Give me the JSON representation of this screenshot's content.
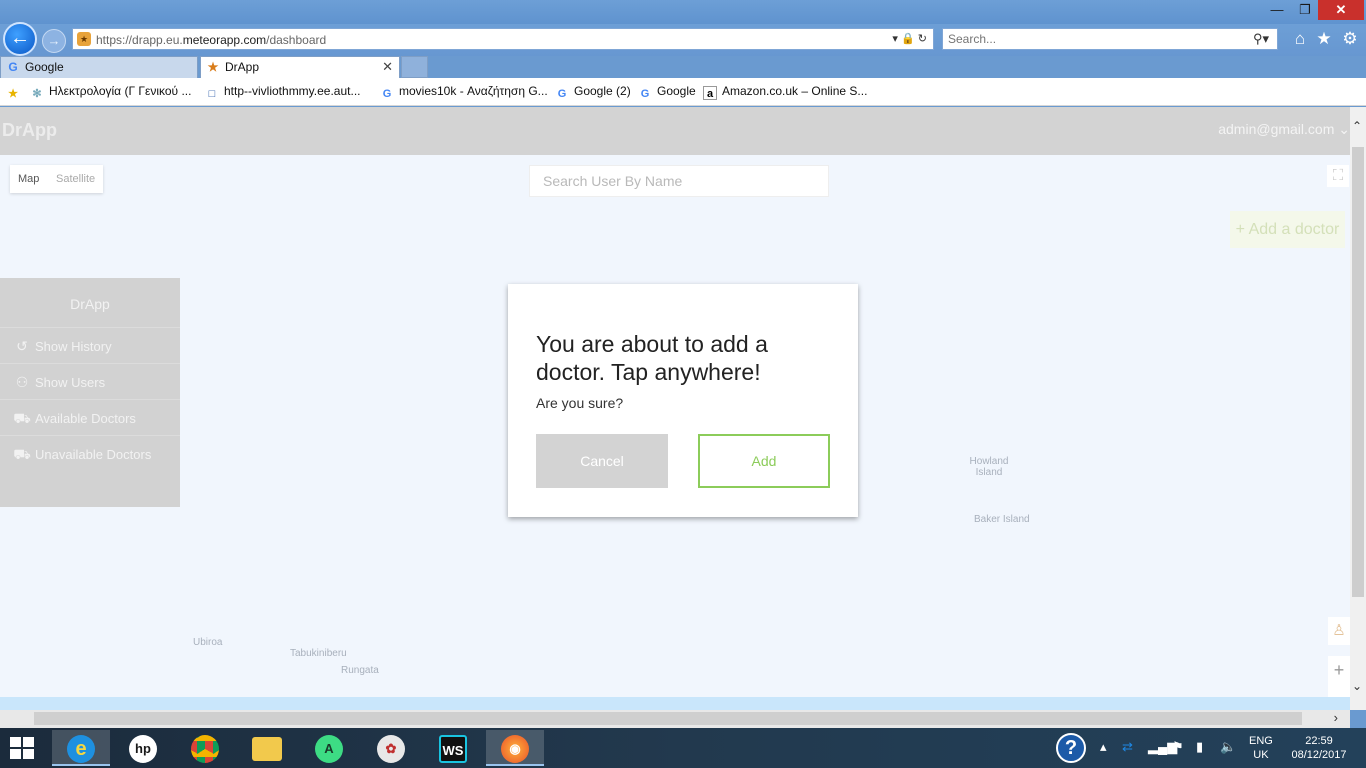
{
  "browser": {
    "url_prefix": "https://drapp.eu.",
    "url_domain": "meteorapp.com",
    "url_path": "/dashboard",
    "search_placeholder": "Search...",
    "tabs": [
      {
        "label": "Google",
        "icon": "google-icon"
      },
      {
        "label": "DrApp",
        "icon": "meteor-icon"
      }
    ],
    "favorites": [
      {
        "label": "Ηλεκτρολογία (Γ Γενικού ...",
        "icon": "page-icon"
      },
      {
        "label": "http--vivliothmmy.ee.aut...",
        "icon": "doc-icon"
      },
      {
        "label": "movies10k - Αναζήτηση G...",
        "icon": "google-icon"
      },
      {
        "label": "Google (2)",
        "icon": "google-icon"
      },
      {
        "label": "Google",
        "icon": "google-icon"
      },
      {
        "label": "Amazon.co.uk – Online S...",
        "icon": "amazon-icon"
      }
    ]
  },
  "app": {
    "brand": "DrApp",
    "user_email": "admin@gmail.com",
    "map_type": {
      "map": "Map",
      "satellite": "Satellite"
    },
    "search_placeholder": "Search User By Name",
    "add_doctor_label": "+ Add a doctor",
    "sidebar": {
      "title": "DrApp",
      "items": [
        {
          "label": "Show History",
          "icon": "history-icon"
        },
        {
          "label": "Show Users",
          "icon": "users-icon"
        },
        {
          "label": "Available Doctors",
          "icon": "car-icon"
        },
        {
          "label": "Unavailable Doctors",
          "icon": "car-icon"
        }
      ]
    },
    "map_labels": {
      "howland": "Howland Island",
      "baker": "Baker Island",
      "ubiroa": "Ubiroa",
      "tabukiniberu": "Tabukiniberu",
      "rungata": "Rungata"
    }
  },
  "modal": {
    "title": "You are about to add a doctor. Tap anywhere!",
    "text": "Are you sure?",
    "cancel": "Cancel",
    "confirm": "Add"
  },
  "taskbar": {
    "lang_line1": "ENG",
    "lang_line2": "UK",
    "time": "22:59",
    "date": "08/12/2017"
  },
  "colors": {
    "accent_green": "#8ccc5a",
    "header_gray": "#d3d3d3",
    "map_water": "#f1f6fd"
  }
}
